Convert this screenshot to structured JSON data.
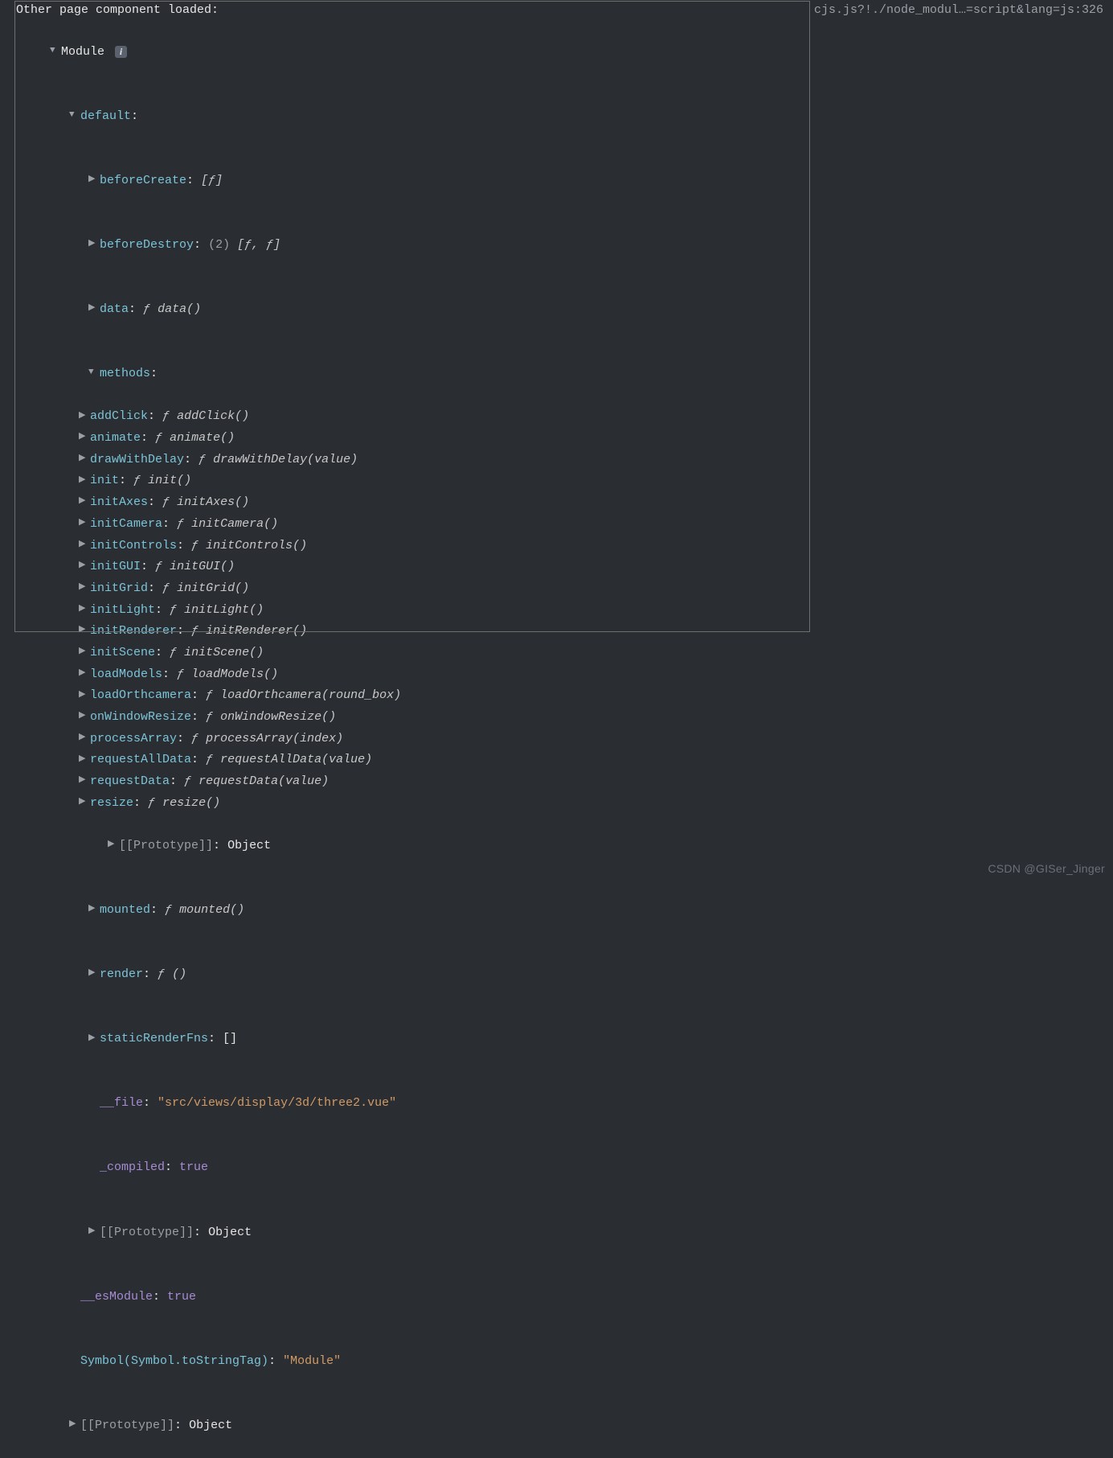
{
  "header": {
    "message": "Other page component loaded:",
    "source": "cjs.js?!./node_modul…=script&lang=js:326"
  },
  "module": {
    "label": "Module",
    "info_icon": "i",
    "default_key": "default",
    "entries": {
      "beforeCreate": {
        "key": "beforeCreate",
        "value": "[ƒ]"
      },
      "beforeDestroy": {
        "key": "beforeDestroy",
        "count": "(2)",
        "value": "[ƒ, ƒ]"
      },
      "data": {
        "key": "data",
        "f": "ƒ",
        "sig": "data()"
      },
      "methods_key": "methods",
      "methods": [
        {
          "key": "addClick",
          "f": "ƒ",
          "sig": "addClick()"
        },
        {
          "key": "animate",
          "f": "ƒ",
          "sig": "animate()"
        },
        {
          "key": "drawWithDelay",
          "f": "ƒ",
          "sig": "drawWithDelay(value)"
        },
        {
          "key": "init",
          "f": "ƒ",
          "sig": "init()"
        },
        {
          "key": "initAxes",
          "f": "ƒ",
          "sig": "initAxes()"
        },
        {
          "key": "initCamera",
          "f": "ƒ",
          "sig": "initCamera()"
        },
        {
          "key": "initControls",
          "f": "ƒ",
          "sig": "initControls()"
        },
        {
          "key": "initGUI",
          "f": "ƒ",
          "sig": "initGUI()"
        },
        {
          "key": "initGrid",
          "f": "ƒ",
          "sig": "initGrid()"
        },
        {
          "key": "initLight",
          "f": "ƒ",
          "sig": "initLight()"
        },
        {
          "key": "initRenderer",
          "f": "ƒ",
          "sig": "initRenderer()"
        },
        {
          "key": "initScene",
          "f": "ƒ",
          "sig": "initScene()"
        },
        {
          "key": "loadModels",
          "f": "ƒ",
          "sig": "loadModels()"
        },
        {
          "key": "loadOrthcamera",
          "f": "ƒ",
          "sig": "loadOrthcamera(round_box)"
        },
        {
          "key": "onWindowResize",
          "f": "ƒ",
          "sig": "onWindowResize()"
        },
        {
          "key": "processArray",
          "f": "ƒ",
          "sig": "processArray(index)"
        },
        {
          "key": "requestAllData",
          "f": "ƒ",
          "sig": "requestAllData(value)"
        },
        {
          "key": "requestData",
          "f": "ƒ",
          "sig": "requestData(value)"
        },
        {
          "key": "resize",
          "f": "ƒ",
          "sig": "resize()"
        }
      ],
      "methodsProto": {
        "key": "[[Prototype]]",
        "value": "Object"
      },
      "mounted": {
        "key": "mounted",
        "f": "ƒ",
        "sig": "mounted()"
      },
      "render": {
        "key": "render",
        "f": "ƒ",
        "sig": "()"
      },
      "staticRenderFns": {
        "key": "staticRenderFns",
        "value": "[]"
      },
      "file": {
        "key": "__file",
        "value": "\"src/views/display/3d/three2.vue\""
      },
      "compiled": {
        "key": "_compiled",
        "value": "true"
      },
      "protoDefault": {
        "key": "[[Prototype]]",
        "value": "Object"
      },
      "esModule": {
        "key": "__esModule",
        "value": "true"
      },
      "symbolTag": {
        "key": "Symbol(Symbol.toStringTag)",
        "value": "\"Module\""
      },
      "protoRoot": {
        "key": "[[Prototype]]",
        "value": "Object"
      }
    }
  },
  "watermark": "CSDN @GISer_Jinger"
}
